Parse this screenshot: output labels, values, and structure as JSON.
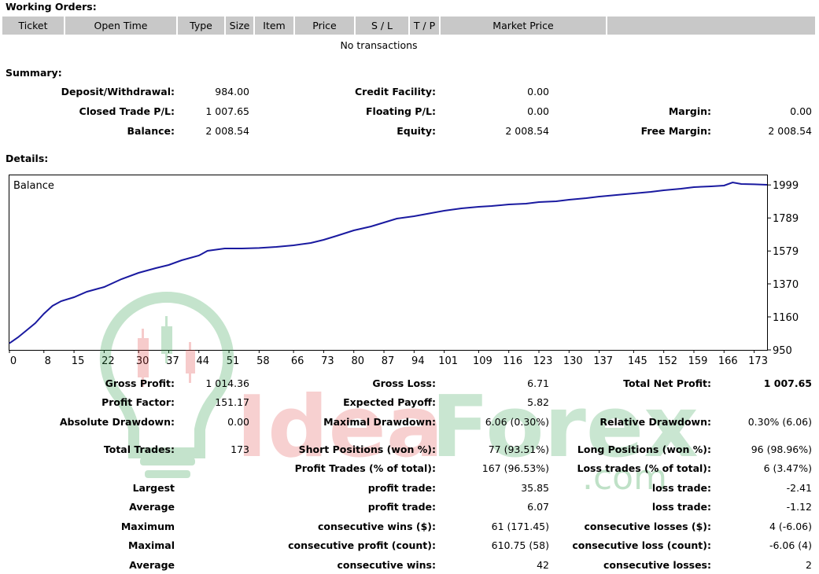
{
  "working_orders": {
    "title": "Working Orders:",
    "columns": [
      "Ticket",
      "Open Time",
      "Type",
      "Size",
      "Item",
      "Price",
      "S / L",
      "T / P",
      "Market Price",
      ""
    ],
    "empty_text": "No transactions"
  },
  "summary": {
    "title": "Summary:",
    "deposit_label": "Deposit/Withdrawal:",
    "deposit_value": "984.00",
    "credit_label": "Credit Facility:",
    "credit_value": "0.00",
    "closed_label": "Closed Trade P/L:",
    "closed_value": "1 007.65",
    "floating_label": "Floating P/L:",
    "floating_value": "0.00",
    "margin_label": "Margin:",
    "margin_value": "0.00",
    "balance_label": "Balance:",
    "balance_value": "2 008.54",
    "equity_label": "Equity:",
    "equity_value": "2 008.54",
    "free_margin_label": "Free Margin:",
    "free_margin_value": "2 008.54"
  },
  "details": {
    "title": "Details:",
    "gross_profit_label": "Gross Profit:",
    "gross_profit_value": "1 014.36",
    "gross_loss_label": "Gross Loss:",
    "gross_loss_value": "6.71",
    "net_profit_label": "Total Net Profit:",
    "net_profit_value": "1 007.65",
    "profit_factor_label": "Profit Factor:",
    "profit_factor_value": "151.17",
    "expected_payoff_label": "Expected Payoff:",
    "expected_payoff_value": "5.82",
    "abs_dd_label": "Absolute Drawdown:",
    "abs_dd_value": "0.00",
    "max_dd_label": "Maximal Drawdown:",
    "max_dd_value": "6.06 (0.30%)",
    "rel_dd_label": "Relative Drawdown:",
    "rel_dd_value": "0.30% (6.06)",
    "total_trades_label": "Total Trades:",
    "total_trades_value": "173",
    "short_label": "Short Positions (won %):",
    "short_value": "77 (93.51%)",
    "long_label": "Long Positions (won %):",
    "long_value": "96 (98.96%)",
    "profit_trades_label": "Profit Trades (% of total):",
    "profit_trades_value": "167 (96.53%)",
    "loss_trades_label": "Loss trades (% of total):",
    "loss_trades_value": "6 (3.47%)",
    "largest_label": "Largest",
    "largest_profit_label": "profit trade:",
    "largest_profit_value": "35.85",
    "largest_loss_label": "loss trade:",
    "largest_loss_value": "-2.41",
    "average_label": "Average",
    "average_profit_label": "profit trade:",
    "average_profit_value": "6.07",
    "average_loss_label": "loss trade:",
    "average_loss_value": "-1.12",
    "maximum_label": "Maximum",
    "max_cons_wins_label": "consecutive wins ($):",
    "max_cons_wins_value": "61 (171.45)",
    "max_cons_losses_label": "consecutive losses ($):",
    "max_cons_losses_value": "4 (-6.06)",
    "maximal_label": "Maximal",
    "maximal_profit_label": "consecutive profit (count):",
    "maximal_profit_value": "610.75 (58)",
    "maximal_loss_label": "consecutive loss (count):",
    "maximal_loss_value": "-6.06 (4)",
    "average2_label": "Average",
    "avg_cons_wins_label": "consecutive wins:",
    "avg_cons_wins_value": "42",
    "avg_cons_losses_label": "consecutive losses:",
    "avg_cons_losses_value": "2"
  },
  "watermark": {
    "brand_left": "Idea",
    "brand_right": "Forex",
    "domain": ".com"
  },
  "colors": {
    "line": "#1a1aa0",
    "header_bg": "#c8c8c8",
    "watermark_green": "#2e9e4a",
    "watermark_red": "#e04848"
  },
  "chart_data": {
    "type": "line",
    "title": "Balance",
    "x_ticks": [
      0,
      8,
      15,
      22,
      30,
      37,
      44,
      51,
      58,
      66,
      73,
      80,
      87,
      94,
      101,
      109,
      116,
      123,
      130,
      137,
      145,
      152,
      159,
      166,
      173
    ],
    "y_ticks": [
      950,
      1160,
      1370,
      1579,
      1789,
      1999
    ],
    "xlim": [
      0,
      176
    ],
    "ylim": [
      950,
      2060
    ],
    "series": [
      {
        "x": [
          0,
          2,
          4,
          6,
          8,
          10,
          12,
          15,
          18,
          22,
          26,
          30,
          34,
          37,
          40,
          44,
          46,
          50,
          54,
          58,
          62,
          66,
          70,
          73,
          76,
          80,
          84,
          87,
          90,
          94,
          98,
          101,
          105,
          109,
          112,
          116,
          120,
          123,
          127,
          130,
          134,
          137,
          141,
          145,
          149,
          152,
          156,
          159,
          163,
          166,
          168,
          170,
          173,
          176
        ],
        "y": [
          992,
          1030,
          1075,
          1120,
          1180,
          1230,
          1260,
          1285,
          1320,
          1350,
          1400,
          1440,
          1470,
          1490,
          1520,
          1550,
          1580,
          1595,
          1595,
          1598,
          1605,
          1615,
          1630,
          1650,
          1675,
          1710,
          1735,
          1760,
          1785,
          1800,
          1820,
          1835,
          1850,
          1860,
          1865,
          1875,
          1880,
          1890,
          1895,
          1905,
          1915,
          1925,
          1935,
          1945,
          1955,
          1965,
          1975,
          1985,
          1990,
          1995,
          2015,
          2005,
          2003,
          2000
        ]
      }
    ]
  }
}
